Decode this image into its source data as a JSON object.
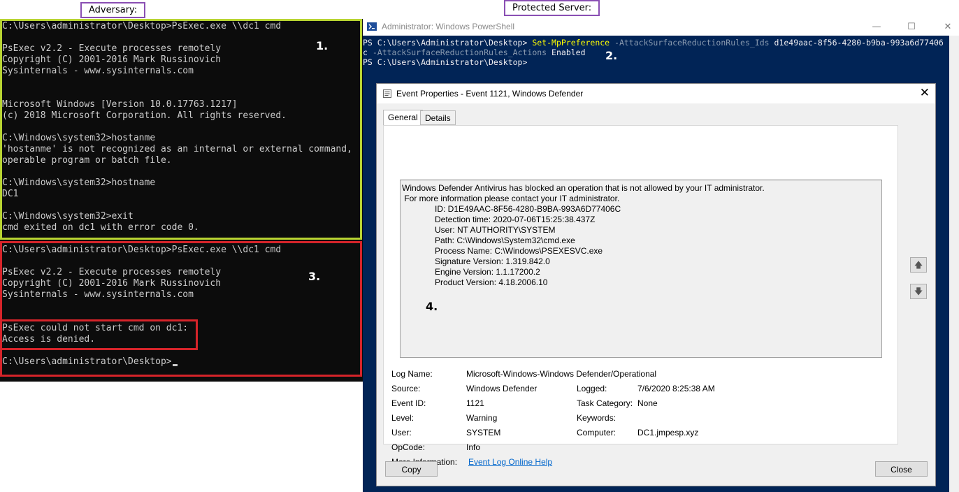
{
  "labels": {
    "adversary": "Adversary:",
    "protected": "Protected Server:"
  },
  "cmd": {
    "lines": [
      "C:\\Users\\administrator\\Desktop>PsExec.exe \\\\dc1 cmd",
      "",
      "PsExec v2.2 - Execute processes remotely",
      "Copyright (C) 2001-2016 Mark Russinovich",
      "Sysinternals - www.sysinternals.com",
      "",
      "",
      "Microsoft Windows [Version 10.0.17763.1217]",
      "(c) 2018 Microsoft Corporation. All rights reserved.",
      "",
      "C:\\Windows\\system32>hostanme",
      "'hostanme' is not recognized as an internal or external command,",
      "operable program or batch file.",
      "",
      "C:\\Windows\\system32>hostname",
      "DC1",
      "",
      "C:\\Windows\\system32>exit",
      "cmd exited on dc1 with error code 0.",
      "",
      "C:\\Users\\administrator\\Desktop>PsExec.exe \\\\dc1 cmd",
      "",
      "PsExec v2.2 - Execute processes remotely",
      "Copyright (C) 2001-2016 Mark Russinovich",
      "Sysinternals - www.sysinternals.com",
      "",
      "",
      "PsExec could not start cmd on dc1:",
      "Access is denied.",
      "",
      "C:\\Users\\administrator\\Desktop>"
    ],
    "step1": "1.",
    "step3": "3."
  },
  "powershell": {
    "title": "Administrator: Windows PowerShell",
    "line1_prompt": "PS C:\\Users\\Administrator\\Desktop> ",
    "line1_cmd": "Set-MpPreference",
    "line1_param": " -AttackSurfaceReductionRules_Ids",
    "line1_value": " d1e49aac-8f56-4280-b9ba-993a6d77406",
    "line2_prefix": "c",
    "line2_param": " -AttackSurfaceReductionRules_Actions",
    "line2_value": " Enabled",
    "line3": "PS C:\\Users\\Administrator\\Desktop>",
    "step2": "2.",
    "minimize": "—",
    "maximize": "☐",
    "close": "✕"
  },
  "dialog": {
    "title": "Event Properties - Event 1121, Windows Defender",
    "close": "✕",
    "tabs": [
      "General",
      "Details"
    ],
    "description": [
      "Windows Defender Antivirus has blocked an operation that is not allowed by your IT administrator.",
      " For more information please contact your IT administrator.",
      "ID: D1E49AAC-8F56-4280-B9BA-993A6D77406C",
      "Detection time: 2020-07-06T15:25:38.437Z",
      "User: NT AUTHORITY\\SYSTEM",
      "Path: C:\\Windows\\System32\\cmd.exe",
      "Process Name: C:\\Windows\\PSEXESVC.exe",
      "Signature Version: 1.319.842.0",
      "Engine Version: 1.1.17200.2",
      "Product Version: 4.18.2006.10"
    ],
    "step4": "4.",
    "fields": {
      "log_name_label": "Log Name:",
      "log_name": "Microsoft-Windows-Windows Defender/Operational",
      "source_label": "Source:",
      "source": "Windows Defender",
      "logged_label": "Logged:",
      "logged": "7/6/2020 8:25:38 AM",
      "event_id_label": "Event ID:",
      "event_id": "1121",
      "task_category_label": "Task Category:",
      "task_category": "None",
      "level_label": "Level:",
      "level": "Warning",
      "keywords_label": "Keywords:",
      "keywords": "",
      "user_label": "User:",
      "user": "SYSTEM",
      "computer_label": "Computer:",
      "computer": "DC1.jmpesp.xyz",
      "opcode_label": "OpCode:",
      "opcode": "Info",
      "more_info_label": "More Information:",
      "more_info_link": "Event Log Online Help"
    },
    "copy_button": "Copy",
    "close_button": "Close",
    "arrow_up": "🡅",
    "arrow_down": "🡇"
  }
}
